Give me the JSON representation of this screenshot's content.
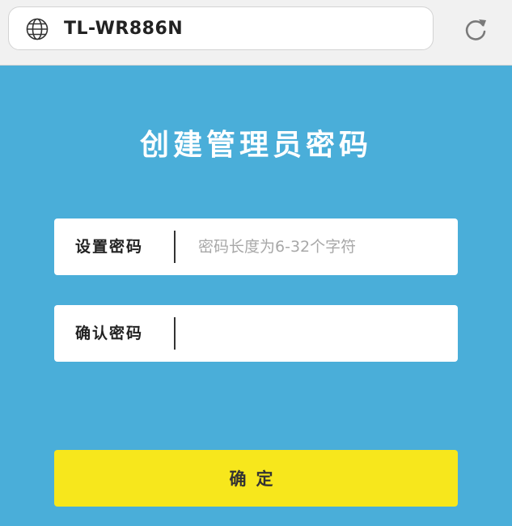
{
  "browser": {
    "url": "TL-WR886N",
    "site_icon": "globe-icon",
    "reload_icon": "reload-icon"
  },
  "page": {
    "title": "创建管理员密码",
    "set_password": {
      "label": "设置密码",
      "placeholder": "密码长度为6-32个字符",
      "value": ""
    },
    "confirm_password": {
      "label": "确认密码",
      "placeholder": "",
      "value": ""
    },
    "submit_label": "确定"
  },
  "colors": {
    "background": "#4aaed9",
    "button": "#f7e71c",
    "browser_bar": "#f1f1f1"
  }
}
